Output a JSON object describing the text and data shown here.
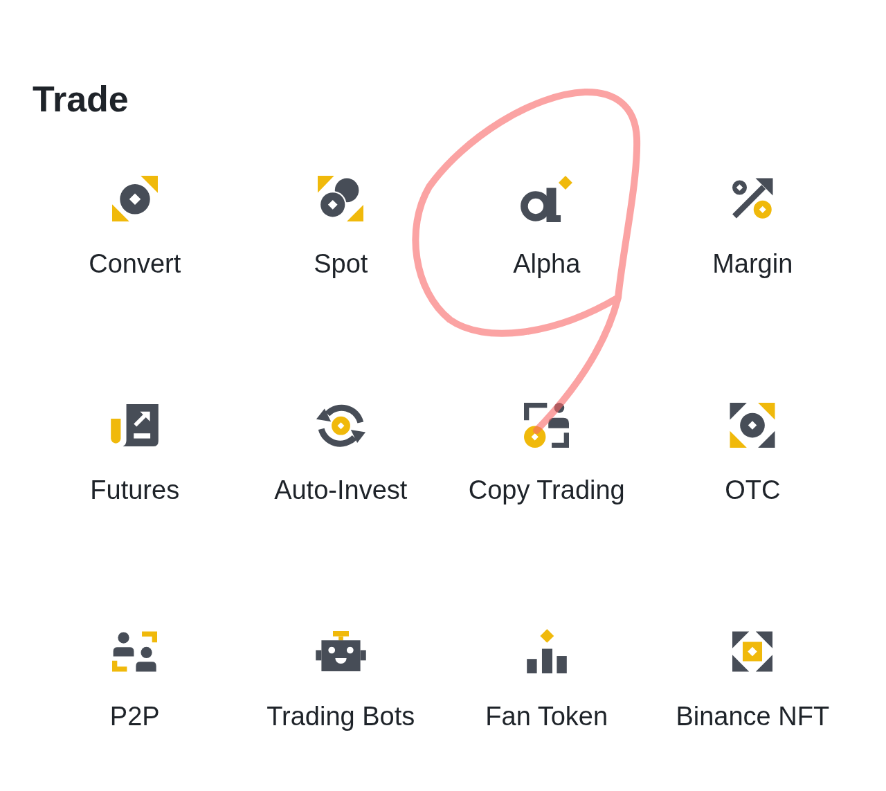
{
  "section": {
    "title": "Trade"
  },
  "items": [
    {
      "label": "Convert",
      "circled": false
    },
    {
      "label": "Spot",
      "circled": false
    },
    {
      "label": "Alpha",
      "circled": true
    },
    {
      "label": "Margin",
      "circled": false
    },
    {
      "label": "Futures",
      "circled": false
    },
    {
      "label": "Auto-Invest",
      "circled": false
    },
    {
      "label": "Copy Trading",
      "circled": false
    },
    {
      "label": "OTC",
      "circled": false
    },
    {
      "label": "P2P",
      "circled": false
    },
    {
      "label": "Trading Bots",
      "circled": false
    },
    {
      "label": "Fan Token",
      "circled": false
    },
    {
      "label": "Binance NFT",
      "circled": false
    }
  ]
}
